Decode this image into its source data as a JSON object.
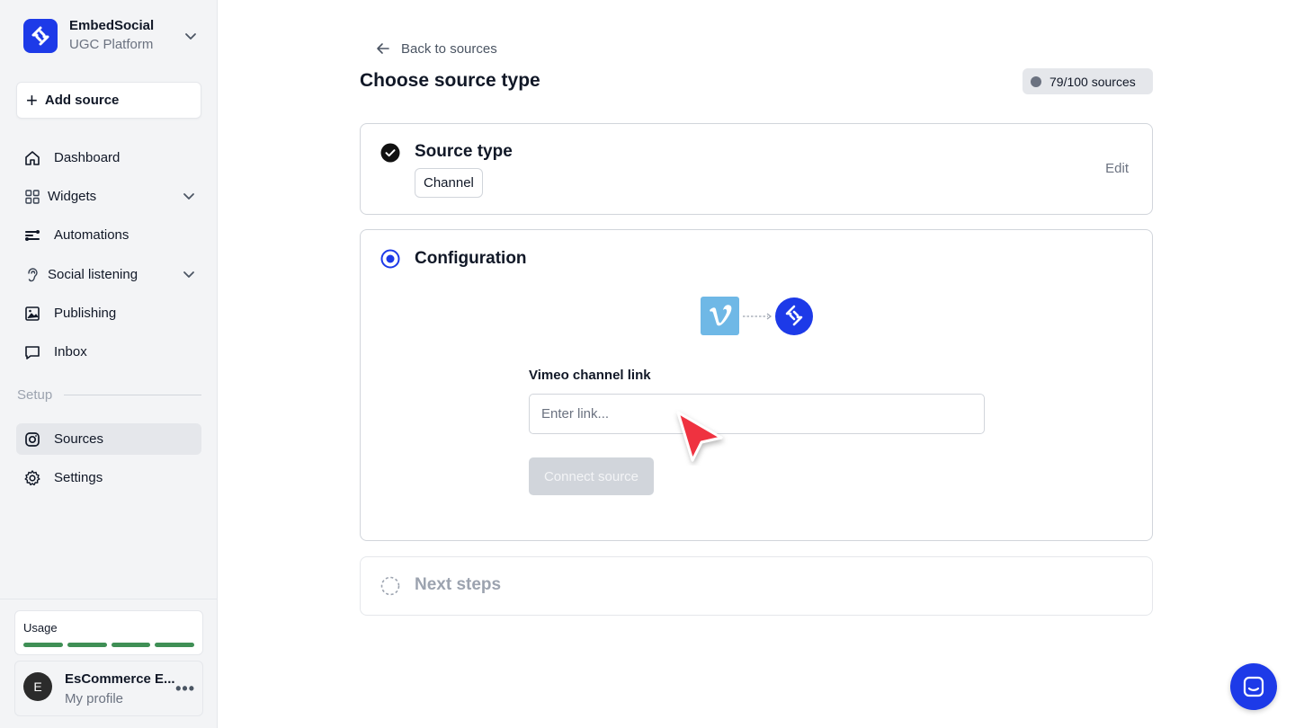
{
  "brand": {
    "name": "EmbedSocial",
    "subtitle": "UGC Platform"
  },
  "sidebar": {
    "add_source_label": "Add source",
    "items": [
      {
        "label": "Dashboard",
        "icon": "home-icon"
      },
      {
        "label": "Widgets",
        "icon": "grid-icon"
      },
      {
        "label": "Automations",
        "icon": "automation-icon"
      },
      {
        "label": "Social listening",
        "icon": "ear-icon"
      },
      {
        "label": "Publishing",
        "icon": "image-icon"
      },
      {
        "label": "Inbox",
        "icon": "chat-bubble-icon"
      }
    ],
    "section_label": "Setup",
    "setup_items": [
      {
        "label": "Sources",
        "icon": "instagram-icon",
        "active": true
      },
      {
        "label": "Settings",
        "icon": "gear-icon"
      }
    ],
    "usage": {
      "label": "Usage",
      "segments": 4
    },
    "profile": {
      "initial": "E",
      "name": "EsCommerce E...",
      "subtitle": "My profile"
    }
  },
  "main": {
    "back_label": "Back to sources",
    "title": "Choose source type",
    "usage_badge": "79/100 sources",
    "steps": {
      "source_type": {
        "title": "Source type",
        "chip": "Channel",
        "edit_label": "Edit"
      },
      "configuration": {
        "title": "Configuration",
        "field_label": "Vimeo channel link",
        "field_placeholder": "Enter link...",
        "field_value": "",
        "button_label": "Connect source"
      },
      "next_steps": {
        "title": "Next steps"
      }
    }
  },
  "colors": {
    "brand_blue": "#1d3ae8",
    "vimeo_blue": "#6fb8e6",
    "usage_green": "#3f8f55",
    "cursor_red": "#ef3340"
  }
}
